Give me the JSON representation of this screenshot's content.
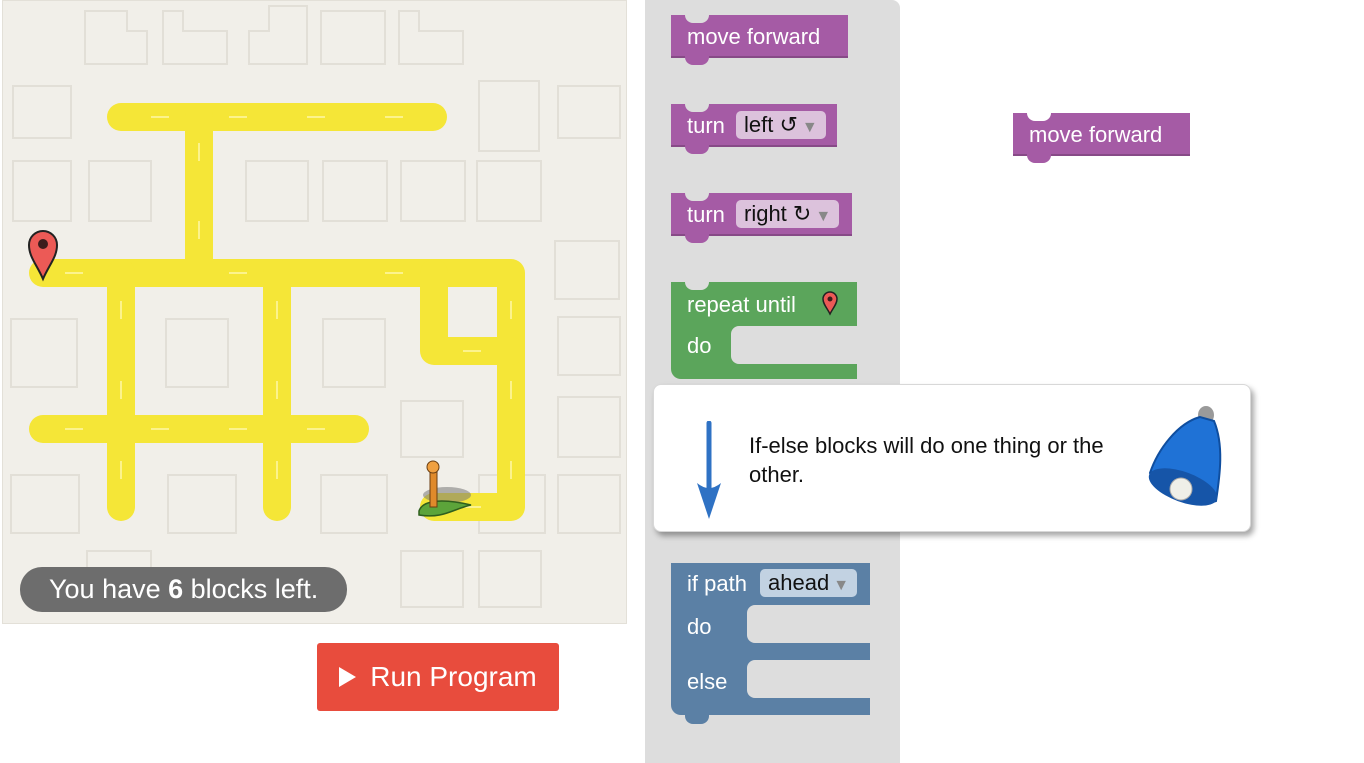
{
  "status": {
    "prefix": "You have ",
    "count": "6",
    "suffix": " blocks left."
  },
  "run_button": {
    "label": "Run Program",
    "icon": "play-icon"
  },
  "toolbox": {
    "move_forward": "move forward",
    "turn_left": {
      "label": "turn",
      "value": "left ↺"
    },
    "turn_right": {
      "label": "turn",
      "value": "right ↻"
    },
    "repeat_until": {
      "label": "repeat until",
      "do": "do",
      "icon": "map-pin-icon"
    },
    "if_path": {
      "label": "if path",
      "value": "ahead",
      "do": "do",
      "else": "else"
    }
  },
  "workspace": {
    "move_forward": "move forward"
  },
  "hint": {
    "text": "If-else blocks will do one thing or the other.",
    "icons": [
      "arrow-down-icon",
      "bell-icon"
    ]
  },
  "colors": {
    "path": "#ffeb3b",
    "motion_block": "#a55ba5",
    "loop_block": "#5ba55b",
    "logic_block": "#5b80a5",
    "run_button": "#e84c3d"
  }
}
